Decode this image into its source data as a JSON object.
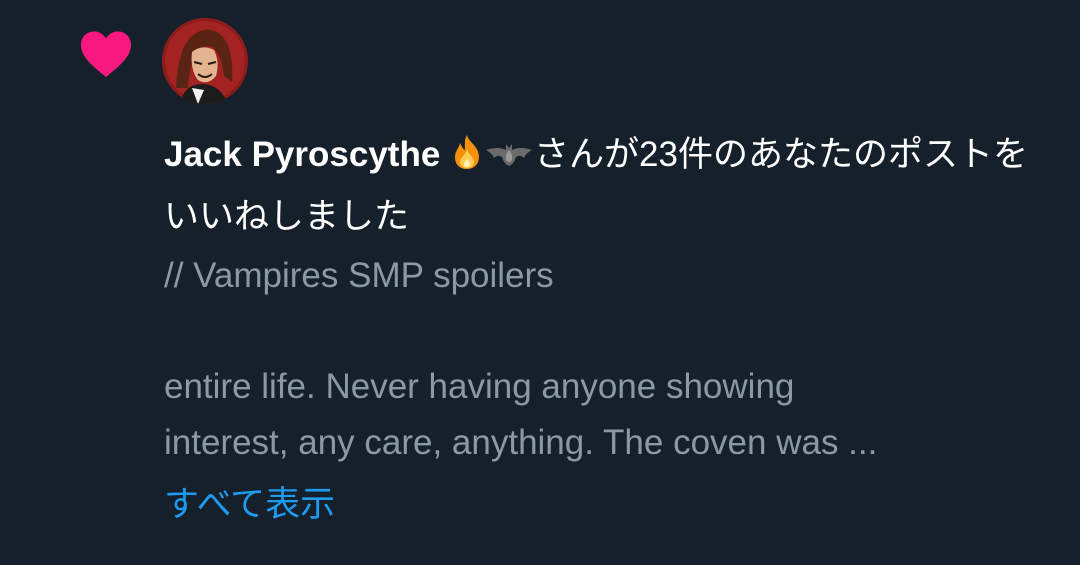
{
  "notification": {
    "icon": "heart-icon",
    "heart_color": "#f91880",
    "avatar": "user-avatar-portrait",
    "user_name": "Jack Pyroscythe ",
    "emojis": [
      "fire-emoji",
      "bat-emoji"
    ],
    "action_text": "さんが23件のあなたのポストをいいねしました",
    "post_lines": [
      "// Vampires SMP spoilers",
      "entire life. Never having anyone showing",
      "interest, any care, anything. The coven was ..."
    ],
    "show_all_label": "すべて表示",
    "link_color": "#1d9bf0"
  }
}
